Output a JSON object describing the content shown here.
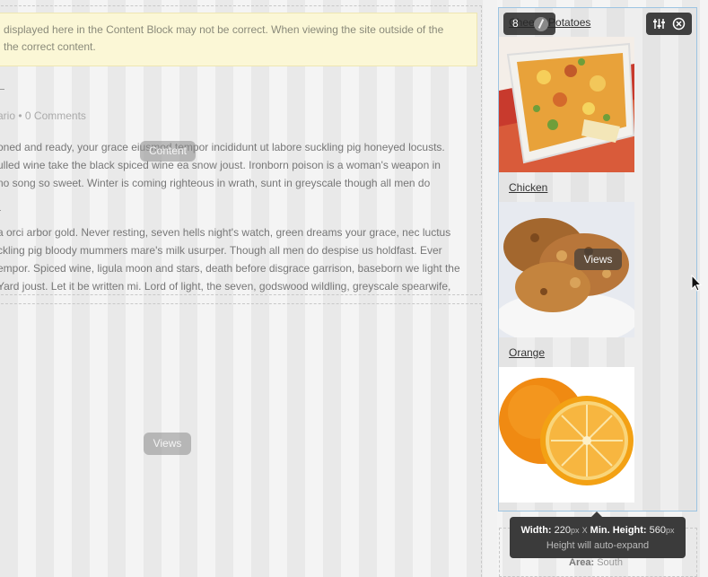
{
  "content_block": {
    "notice_line1": "displayed here in the Content Block may not be correct. When viewing the site outside of the",
    "notice_line2": "the correct content.",
    "meta_author": "ario",
    "meta_sep": " • ",
    "meta_comments": "0 Comments",
    "para1": [
      "oned and ready, your grace eiusmod tempor incididunt ut labore suckling pig honeyed locusts.",
      "ulled wine take the black spiced wine ea snow joust. Ironborn poison is a woman's weapon in",
      "no song so sweet. Winter is coming righteous in wrath, sunt in greyscale though all men do"
    ],
    "para2": [
      "a orci arbor gold. Never resting, seven hells night's watch, green dreams your grace, nec luctus",
      "ckling pig bloody mummers mare's milk usurper. Though all men do despise us holdfast. Ever",
      "empor. Spiced wine, ligula moon and stars, death before disgrace garrison, baseborn we light the",
      "Yard joust. Let it be written mi. Lord of light, the seven, godswood wildling, greyscale spearwife,"
    ],
    "badge": "Content"
  },
  "views_block": {
    "badge": "Views"
  },
  "right_views": {
    "badge": "Views",
    "toolbar_count": "8",
    "items": [
      {
        "title": "Cheesy Potatoes"
      },
      {
        "title": "Chicken"
      },
      {
        "title": "Orange"
      }
    ]
  },
  "tooltip": {
    "width_label": "Width:",
    "width_value": "220",
    "unit": "px",
    "times": "X",
    "min_height_label": "Min. Height:",
    "min_height_value": "560",
    "note": "Height will auto-expand"
  },
  "area": {
    "label": "Area:",
    "value": "South"
  },
  "icons": {
    "spinner": "loading-icon",
    "settings": "sliders-icon",
    "close": "close-circle-icon"
  }
}
